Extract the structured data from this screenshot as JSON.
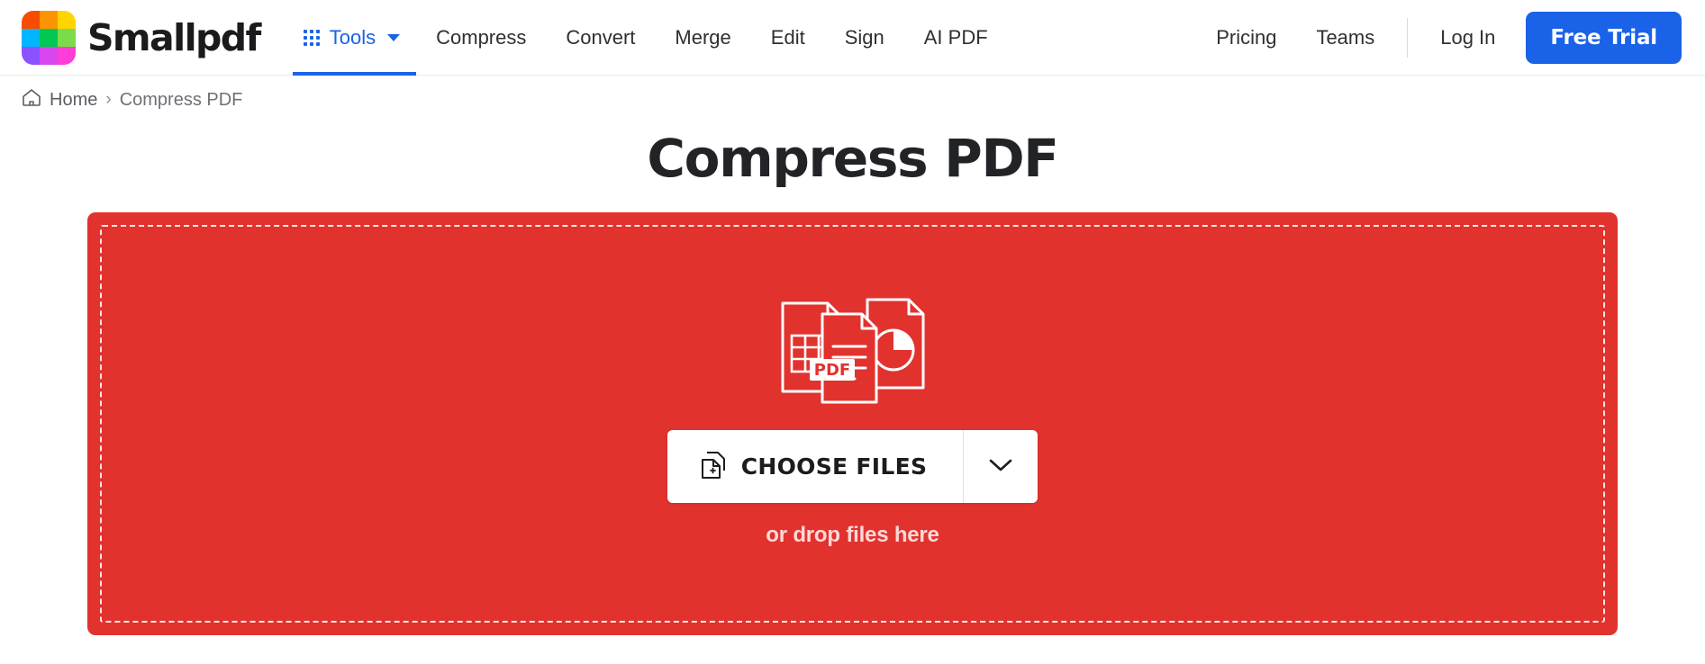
{
  "header": {
    "brand_name": "Smallpdf",
    "logo_colors": [
      "#F74C00",
      "#FB9400",
      "#FFD400",
      "#00B7FF",
      "#00C853",
      "#7BDC4B",
      "#8C52FF",
      "#D946EF",
      "#FF3DD8"
    ],
    "tools": {
      "label": "Tools",
      "grid_icon": "grid-icon",
      "caret_icon": "chevron-down-icon"
    },
    "nav_items": [
      {
        "label": "Compress"
      },
      {
        "label": "Convert"
      },
      {
        "label": "Merge"
      },
      {
        "label": "Edit"
      },
      {
        "label": "Sign"
      },
      {
        "label": "AI PDF"
      }
    ],
    "right_items": [
      {
        "label": "Pricing"
      },
      {
        "label": "Teams"
      }
    ],
    "login_label": "Log In",
    "trial_label": "Free Trial",
    "accent_color": "#1a62e8"
  },
  "breadcrumb": {
    "home_icon": "home-icon",
    "home_label": "Home",
    "separator": "›",
    "current_label": "Compress PDF"
  },
  "main": {
    "title": "Compress PDF",
    "dropzone": {
      "background_color": "#e2322e",
      "illustration_icon": "documents-pdf-illustration",
      "pdf_badge": "PDF",
      "choose_files_label": "CHOOSE FILES",
      "choose_files_icon": "file-plus-icon",
      "dropdown_icon": "chevron-down-icon",
      "drop_hint": "or drop files here"
    }
  }
}
